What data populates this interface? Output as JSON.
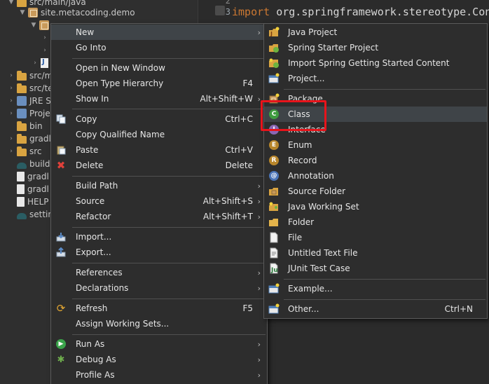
{
  "explorer": {
    "rows": [
      {
        "label": "src/main/java",
        "icon": "folder-icon"
      },
      {
        "label": "site.metacoding.demo",
        "icon": "package-icon"
      },
      {
        "label": "",
        "icon": "package-icon"
      },
      {
        "label": "",
        "icon": "chevron-right-icon"
      },
      {
        "label": "",
        "icon": "chevron-right-icon"
      },
      {
        "label": "J",
        "icon": "java-file-icon"
      },
      {
        "label": "src/m",
        "icon": "folder-icon"
      },
      {
        "label": "src/te",
        "icon": "folder-icon"
      },
      {
        "label": "JRE S",
        "icon": "library-icon"
      },
      {
        "label": "Proje",
        "icon": "library-icon"
      },
      {
        "label": "bin",
        "icon": "folder-icon"
      },
      {
        "label": "gradl",
        "icon": "folder-icon"
      },
      {
        "label": "src",
        "icon": "folder-icon"
      },
      {
        "label": "build",
        "icon": "gradle-icon"
      },
      {
        "label": "gradl",
        "icon": "file-icon"
      },
      {
        "label": "gradl",
        "icon": "file-icon"
      },
      {
        "label": "HELP",
        "icon": "file-icon"
      },
      {
        "label": "settin",
        "icon": "gradle-icon"
      }
    ]
  },
  "editor": {
    "line2": "2",
    "line3": "3",
    "import_kw": "import",
    "import_path": "org.springframework.stereotype.Contr"
  },
  "context_menu": {
    "items": [
      {
        "label": "New",
        "shortcut": "",
        "submenu": true
      },
      {
        "label": "Go Into",
        "shortcut": "",
        "submenu": false
      },
      {
        "label": "Open in New Window",
        "shortcut": "",
        "submenu": false
      },
      {
        "label": "Open Type Hierarchy",
        "shortcut": "F4",
        "submenu": false
      },
      {
        "label": "Show In",
        "shortcut": "Alt+Shift+W",
        "submenu": true
      },
      {
        "label": "Copy",
        "shortcut": "Ctrl+C",
        "submenu": false
      },
      {
        "label": "Copy Qualified Name",
        "shortcut": "",
        "submenu": false
      },
      {
        "label": "Paste",
        "shortcut": "Ctrl+V",
        "submenu": false
      },
      {
        "label": "Delete",
        "shortcut": "Delete",
        "submenu": false
      },
      {
        "label": "Build Path",
        "shortcut": "",
        "submenu": true
      },
      {
        "label": "Source",
        "shortcut": "Alt+Shift+S",
        "submenu": true
      },
      {
        "label": "Refactor",
        "shortcut": "Alt+Shift+T",
        "submenu": true
      },
      {
        "label": "Import...",
        "shortcut": "",
        "submenu": false
      },
      {
        "label": "Export...",
        "shortcut": "",
        "submenu": false
      },
      {
        "label": "References",
        "shortcut": "",
        "submenu": true
      },
      {
        "label": "Declarations",
        "shortcut": "",
        "submenu": true
      },
      {
        "label": "Refresh",
        "shortcut": "F5",
        "submenu": false
      },
      {
        "label": "Assign Working Sets...",
        "shortcut": "",
        "submenu": false
      },
      {
        "label": "Run As",
        "shortcut": "",
        "submenu": true
      },
      {
        "label": "Debug As",
        "shortcut": "",
        "submenu": true
      },
      {
        "label": "Profile As",
        "shortcut": "",
        "submenu": true
      }
    ]
  },
  "new_submenu": {
    "items": [
      {
        "label": "Java Project",
        "shortcut": ""
      },
      {
        "label": "Spring Starter Project",
        "shortcut": ""
      },
      {
        "label": "Import Spring Getting Started Content",
        "shortcut": ""
      },
      {
        "label": "Project...",
        "shortcut": ""
      },
      {
        "label": "Package",
        "shortcut": ""
      },
      {
        "label": "Class",
        "shortcut": ""
      },
      {
        "label": "Interface",
        "shortcut": ""
      },
      {
        "label": "Enum",
        "shortcut": ""
      },
      {
        "label": "Record",
        "shortcut": ""
      },
      {
        "label": "Annotation",
        "shortcut": ""
      },
      {
        "label": "Source Folder",
        "shortcut": ""
      },
      {
        "label": "Java Working Set",
        "shortcut": ""
      },
      {
        "label": "Folder",
        "shortcut": ""
      },
      {
        "label": "File",
        "shortcut": ""
      },
      {
        "label": "Untitled Text File",
        "shortcut": ""
      },
      {
        "label": "JUnit Test Case",
        "shortcut": ""
      },
      {
        "label": "Example...",
        "shortcut": ""
      },
      {
        "label": "Other...",
        "shortcut": "Ctrl+N"
      }
    ]
  },
  "colors": {
    "highlight_box": "#e8141b",
    "menu_bg": "#2d2d2d",
    "menu_hover": "#3f4448",
    "keyword": "#cc7832"
  }
}
